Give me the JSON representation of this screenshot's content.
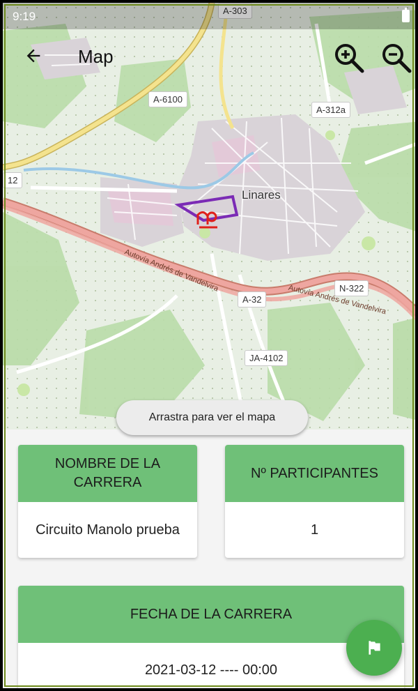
{
  "status_bar": {
    "time": "9:19"
  },
  "app_bar": {
    "title": "Map"
  },
  "map": {
    "town": "Linares",
    "road_labels": [
      "A-303",
      "A-6100",
      "A-312a",
      "A-32",
      "N-322",
      "JA-4102",
      "12"
    ],
    "road_names": [
      "Autovía Andrés de Vandelvira",
      "Autovía Andrés de Vandelvira"
    ],
    "hint": "Arrastra para ver el mapa",
    "route_color": "#7b2bb5"
  },
  "cards": {
    "race_name": {
      "header": "NOMBRE DE LA CARRERA",
      "value": "Circuito Manolo prueba"
    },
    "participants": {
      "header": "Nº PARTICIPANTES",
      "value": "1"
    },
    "race_date": {
      "header": "FECHA DE LA CARRERA",
      "value": "2021-03-12 ---- 00:00"
    }
  },
  "fab": {
    "icon": "flag-icon"
  },
  "colors": {
    "card_header": "#6fc078",
    "fab": "#4caf50"
  }
}
